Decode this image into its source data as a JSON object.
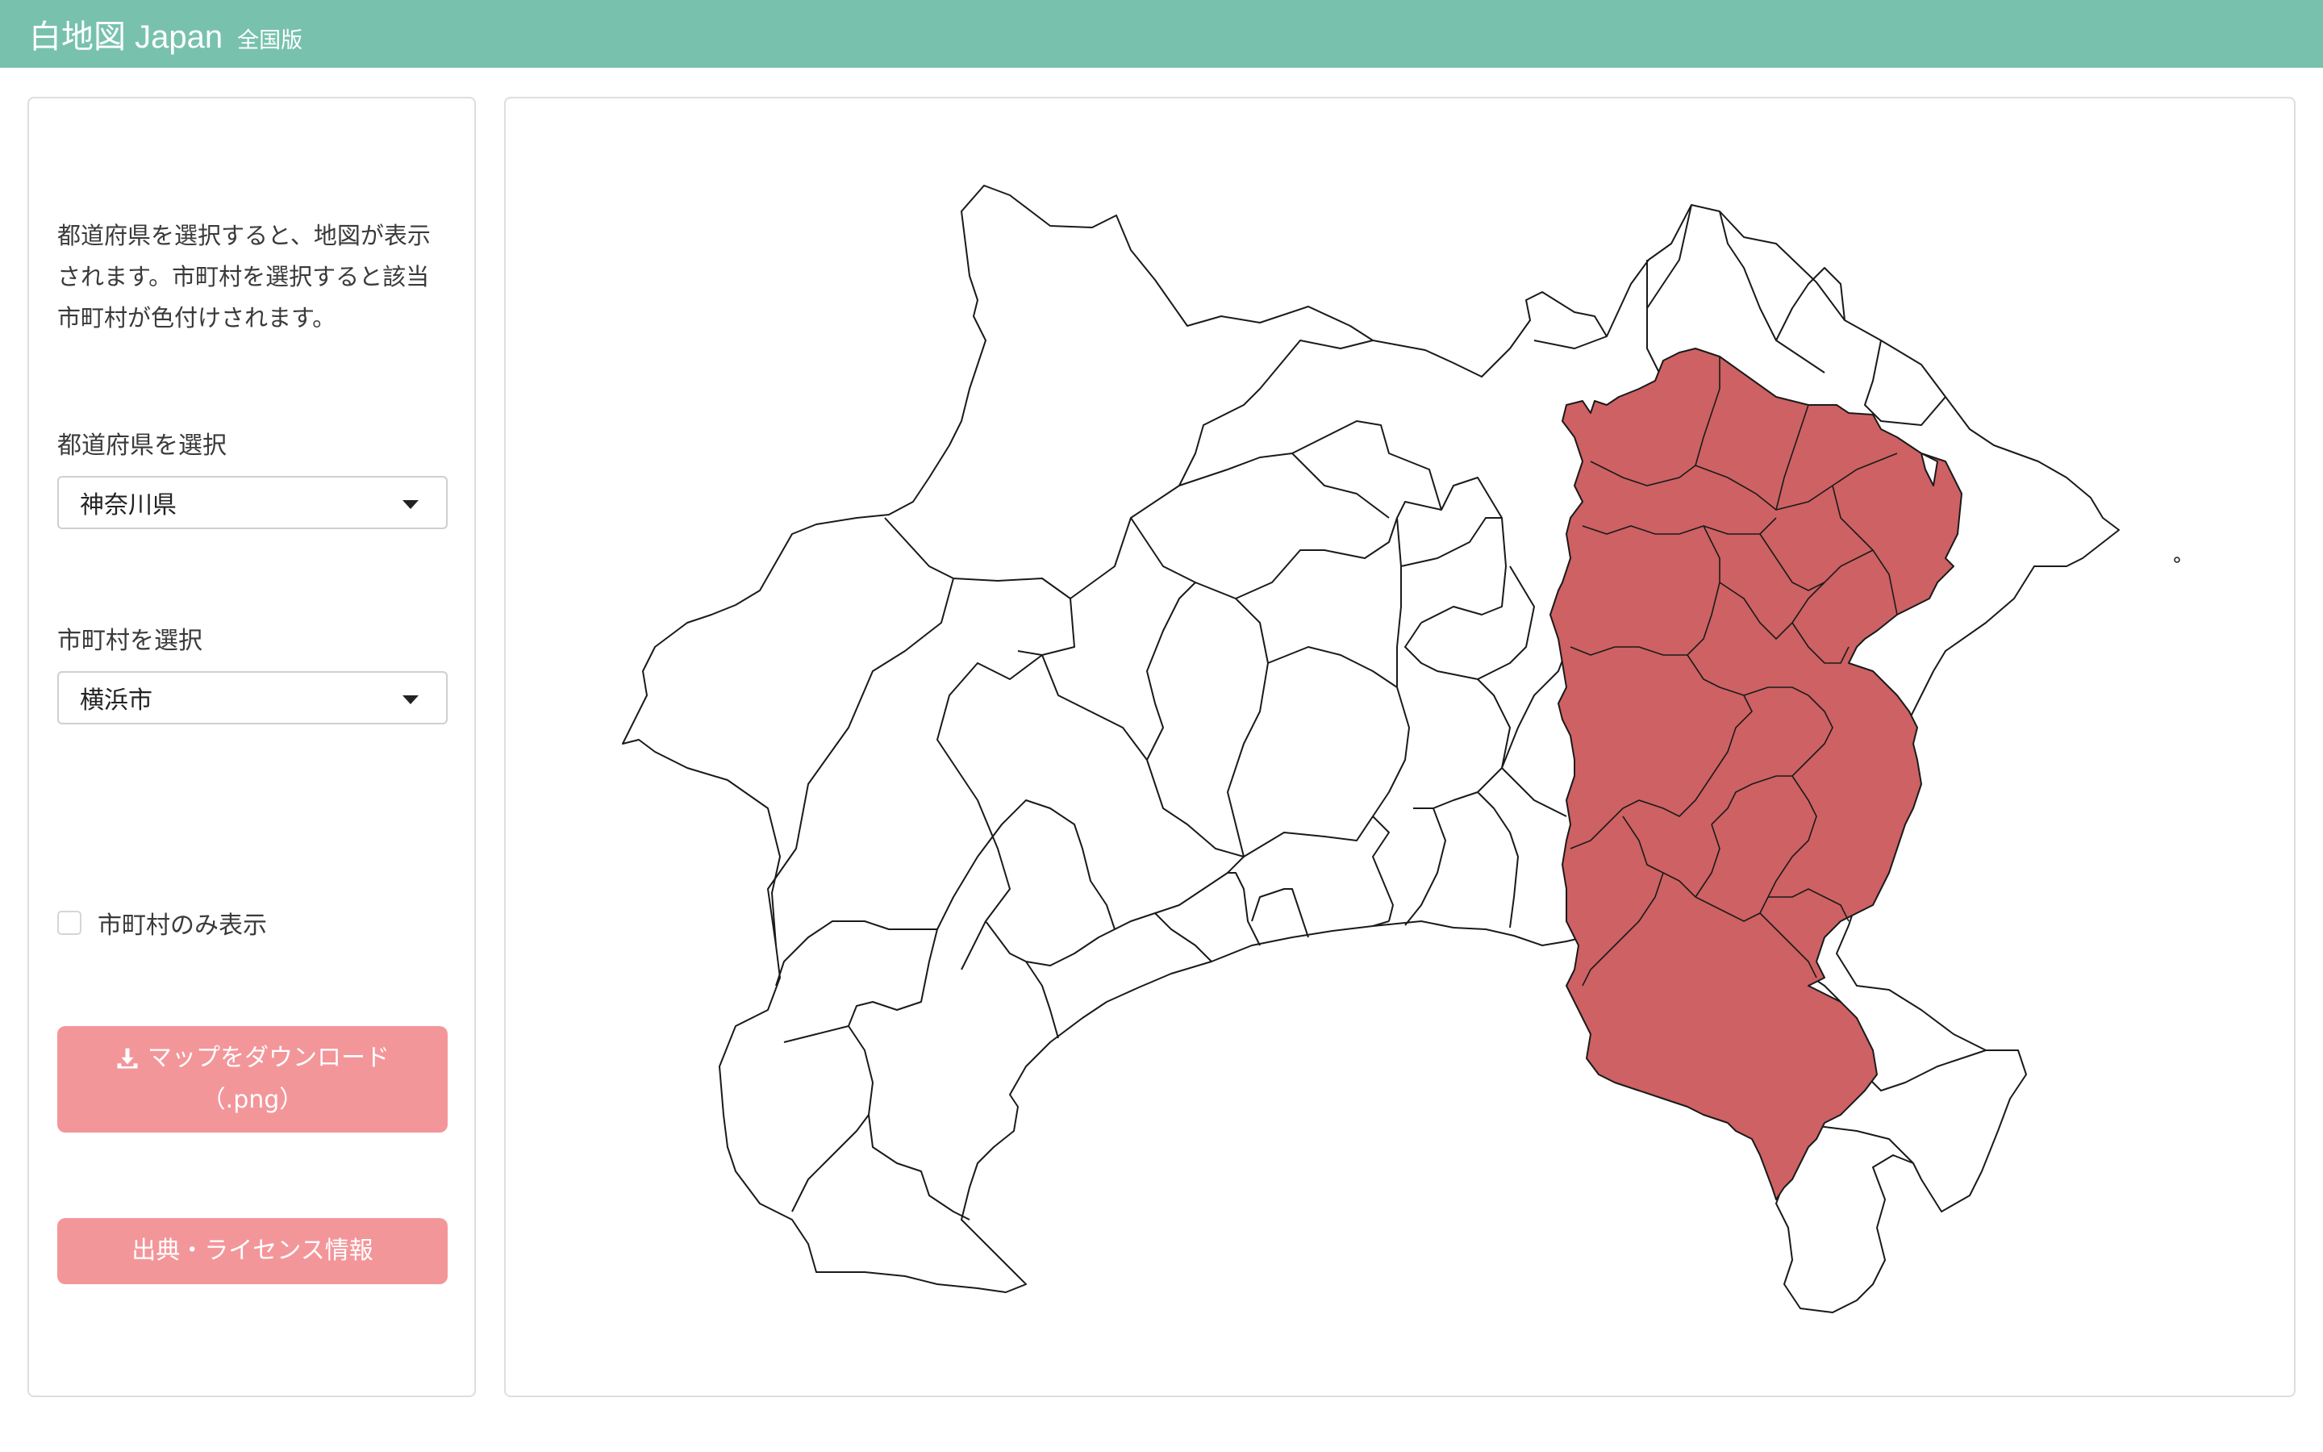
{
  "navbar": {
    "title": "白地図 Japan",
    "subtitle": "全国版",
    "background_color": "#78c2ad"
  },
  "sidebar": {
    "description": "都道府県を選択すると、地図が表示されます。市町村を選択すると該当市町村が色付けされます。",
    "prefecture_label": "都道府県を選択",
    "prefecture_value": "神奈川県",
    "municipality_label": "市町村を選択",
    "municipality_value": "横浜市",
    "only_municipality_label": "市町村のみ表示",
    "only_municipality_checked": false,
    "download_button_line1": "マップをダウンロード",
    "download_button_line2": "（.png）",
    "download_icon": "download-icon",
    "license_button": "出典・ライセンス情報",
    "button_color": "#f3969a"
  },
  "map": {
    "prefecture": "神奈川県",
    "highlighted_municipality": "横浜市",
    "highlight_color": "#cd6163",
    "outline_color": "#1a1a1a"
  }
}
